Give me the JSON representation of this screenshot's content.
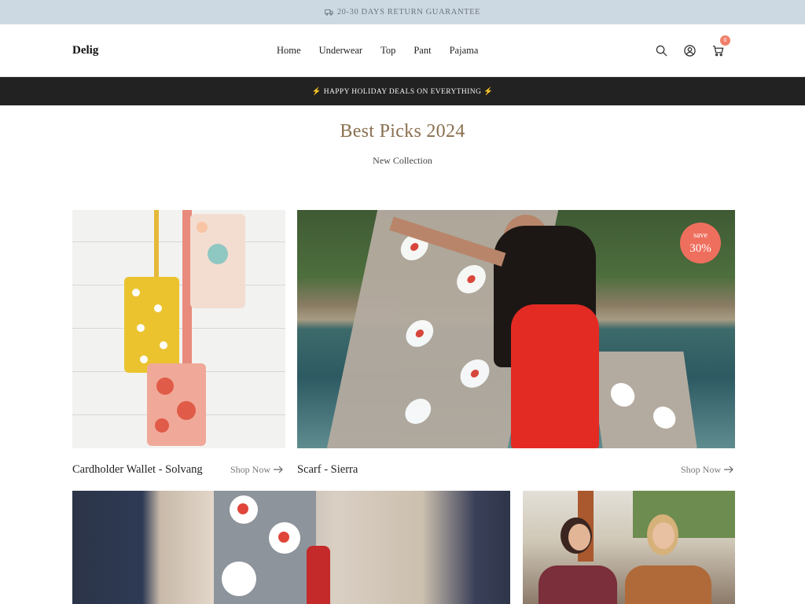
{
  "announcement": {
    "text": "20-30 DAYS RETURN GUARANTEE",
    "icon": "truck-icon"
  },
  "header": {
    "logo": "Delig",
    "nav": [
      "Home",
      "Underwear",
      "Top",
      "Pant",
      "Pajama"
    ],
    "icons": [
      "search-icon",
      "user-icon",
      "cart-icon"
    ],
    "cart_count": "0"
  },
  "promo": {
    "text": "⚡ HAPPY HOLIDAY DEALS ON EVERYTHING ⚡"
  },
  "section": {
    "title": "Best Picks 2024",
    "subtitle": "New Collection"
  },
  "products": [
    {
      "title": "Cardholder Wallet - Solvang",
      "cta": "Shop Now"
    },
    {
      "title": "Scarf - Sierra",
      "cta": "Shop Now",
      "badge_top": "save",
      "badge_value": "30%"
    }
  ],
  "colors": {
    "announcement_bg": "#cdd9e2",
    "promo_bg": "#222222",
    "title_color": "#8a6f4f",
    "badge_bg": "#ef6f5e"
  }
}
